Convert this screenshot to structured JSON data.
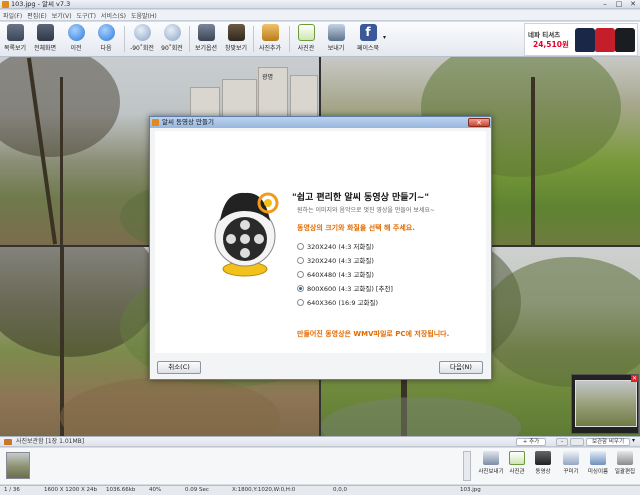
{
  "window": {
    "title": "103.jpg - 알씨 v7.3"
  },
  "menu": [
    "파일(F)",
    "편집(E)",
    "보기(V)",
    "도구(T)",
    "서비스(S)",
    "도움말(H)"
  ],
  "toolbar": {
    "items": [
      {
        "label": "목록보기",
        "icon": "list-view-icon"
      },
      {
        "label": "전체화면",
        "icon": "fullscreen-icon"
      },
      {
        "label": "이전",
        "icon": "prev-arrow-icon"
      },
      {
        "label": "다음",
        "icon": "next-arrow-icon"
      },
      {
        "label": "-90˚회전",
        "icon": "rotate-left-icon"
      },
      {
        "label": "90˚회전",
        "icon": "rotate-right-icon"
      },
      {
        "label": "보기옵션",
        "icon": "view-options-icon"
      },
      {
        "label": "창맞보기",
        "icon": "fit-window-icon"
      },
      {
        "label": "사진추가",
        "icon": "add-photo-icon"
      },
      {
        "label": "사진관",
        "icon": "photo-studio-icon"
      },
      {
        "label": "보내기",
        "icon": "send-icon"
      },
      {
        "label": "페이스북",
        "icon": "facebook-icon"
      }
    ],
    "more": "▾"
  },
  "ad": {
    "line1": "네파 티셔츠",
    "line2": "24,510원"
  },
  "photos": {
    "sign": "광명"
  },
  "dialog": {
    "title": "알씨 동영상 만들기",
    "heading": "\"쉽고 편리한 알씨 동영상 만들기~\"",
    "subtitle": "원하는 이미지와 음악으로 멋진 영상을 만들어 보세요~",
    "prompt": "동영상의 크기와 화질을 선택 해 주세요.",
    "options": [
      {
        "label": "320X240 (4:3 저화질)",
        "selected": false
      },
      {
        "label": "320X240 (4:3 고화질)",
        "selected": false
      },
      {
        "label": "640X480 (4:3 고화질)",
        "selected": false
      },
      {
        "label": "800X600 (4:3 고화질) [추천]",
        "selected": true
      },
      {
        "label": "640X360 (16:9 고화질)",
        "selected": false
      }
    ],
    "note": "만들어진 동영상은 WMV파일로 PC에 저장됩니다.",
    "cancel": "취소(C)",
    "next": "다음(N)"
  },
  "tray": {
    "label": "사진보관함 [1장 1.01MB]",
    "add": "+ 추가",
    "storage": "보관함 비우기",
    "actions": [
      {
        "label": "사진보내기",
        "icon": "send-photo-icon"
      },
      {
        "label": "사진관",
        "icon": "photo-studio-icon"
      },
      {
        "label": "동영상",
        "icon": "video-icon"
      },
      {
        "label": "꾸미기",
        "icon": "decorate-icon"
      },
      {
        "label": "미싱이름",
        "icon": "rename-icon"
      },
      {
        "label": "일괄편집",
        "icon": "batch-edit-icon"
      }
    ]
  },
  "status": {
    "index": "1 / 36",
    "dimensions": "1600 X 1200 X 24b",
    "filesize": "1036.66kb",
    "zoom": "40%",
    "time": "0.09 Sec",
    "coords": "X:1800,Y:1020,W:0,H:0",
    "pos": "0,0,0",
    "filename": "103.jpg"
  },
  "colors": {
    "accent": "#e26a00",
    "titlebar": "#97b6de"
  }
}
